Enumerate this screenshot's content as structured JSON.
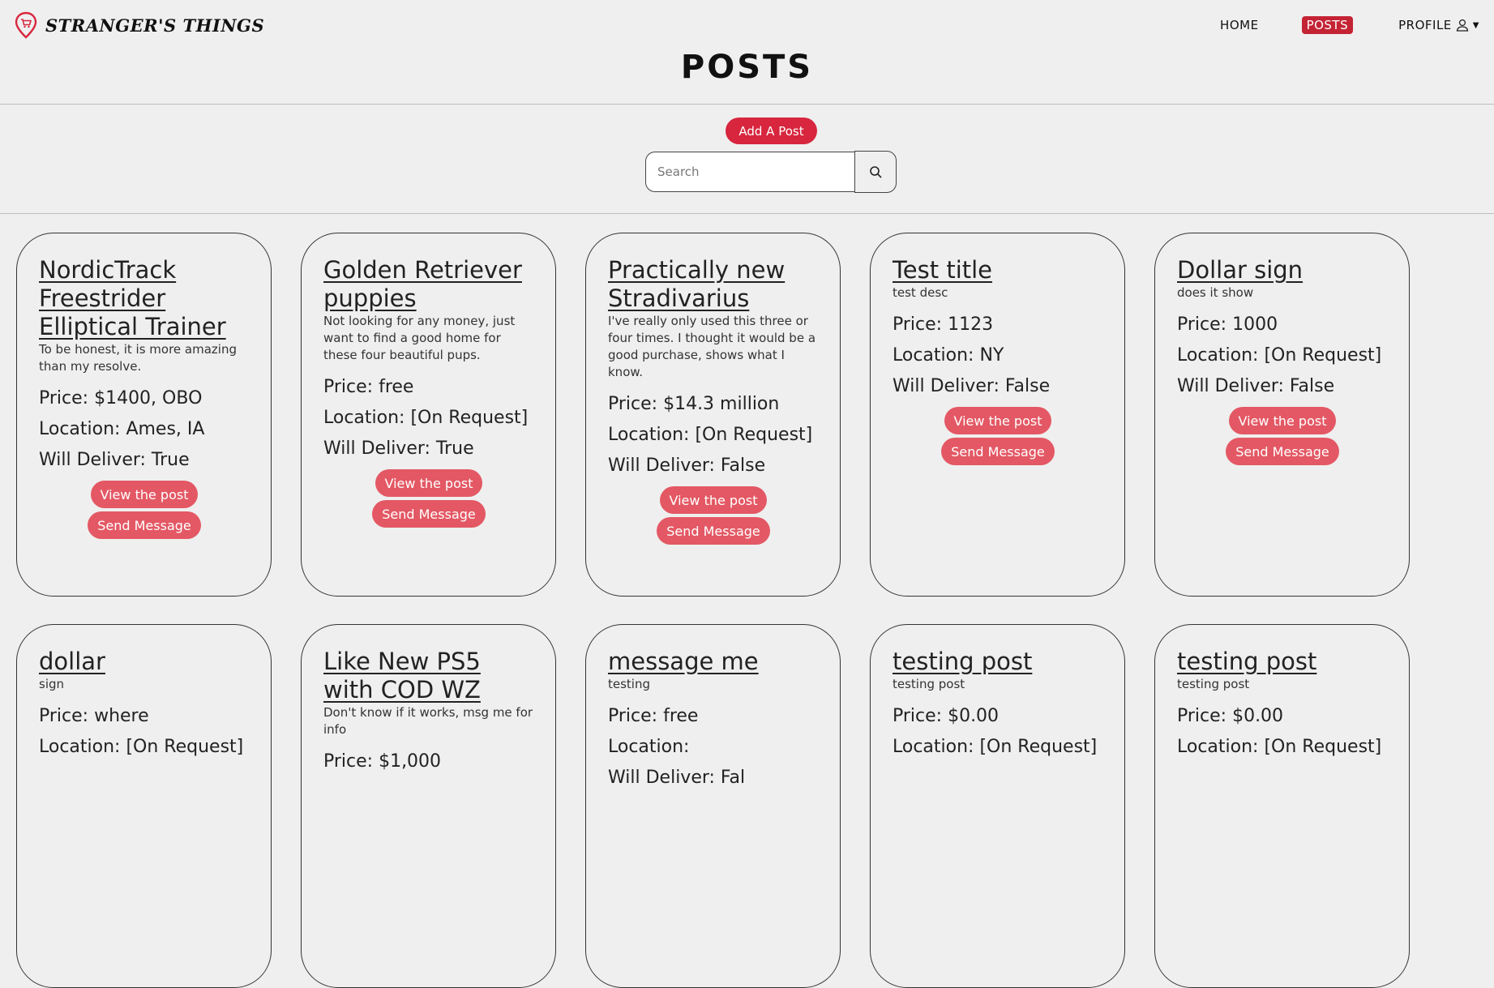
{
  "brand": {
    "name": "STRANGER'S THINGS",
    "logo_icon": "map-pin-cart-icon",
    "logo_color": "#d7263d"
  },
  "nav": {
    "home": "HOME",
    "posts": "POSTS",
    "profile": "PROFILE",
    "active": "posts",
    "accent": "#c42334"
  },
  "page": {
    "title": "POSTS",
    "add_post": "Add A Post",
    "search_placeholder": "Search"
  },
  "buttons": {
    "view": "View the post",
    "message": "Send Message",
    "color": "#e35864"
  },
  "posts": [
    {
      "title": "NordicTrack Freestrider Elliptical Trainer",
      "description": "To be honest, it is more amazing than my resolve.",
      "price": "Price: $1400, OBO",
      "location": "Location: Ames, IA",
      "deliver": "Will Deliver: True"
    },
    {
      "title": "Golden Retriever puppies",
      "description": "Not looking for any money, just want to find a good home for these four beautiful pups.",
      "price": "Price: free",
      "location": "Location: [On Request]",
      "deliver": "Will Deliver: True"
    },
    {
      "title": "Practically new Stradivarius",
      "description": "I've really only used this three or four times. I thought it would be a good purchase, shows what I know.",
      "price": "Price: $14.3 million",
      "location": "Location: [On Request]",
      "deliver": "Will Deliver: False"
    },
    {
      "title": "Test title",
      "description": "test desc",
      "price": "Price: 1123",
      "location": "Location: NY",
      "deliver": "Will Deliver: False"
    },
    {
      "title": "Dollar sign",
      "description": "does it show",
      "price": "Price: 1000",
      "location": "Location: [On Request]",
      "deliver": "Will Deliver: False"
    },
    {
      "title": "dollar",
      "description": "sign",
      "price": "Price: where",
      "location": "Location: [On Request]",
      "deliver": ""
    },
    {
      "title": "Like New PS5 with COD WZ",
      "description": "Don't know if it works, msg me for info",
      "price": "Price: $1,000",
      "location": "",
      "deliver": ""
    },
    {
      "title": "message me",
      "description": "testing",
      "price": "Price: free",
      "location": "Location:",
      "deliver": "Will Deliver: Fal"
    },
    {
      "title": "testing post",
      "description": "testing post",
      "price": "Price: $0.00",
      "location": "Location: [On Request]",
      "deliver": ""
    },
    {
      "title": "testing post",
      "description": "testing post",
      "price": "Price: $0.00",
      "location": "Location: [On Request]",
      "deliver": ""
    }
  ]
}
